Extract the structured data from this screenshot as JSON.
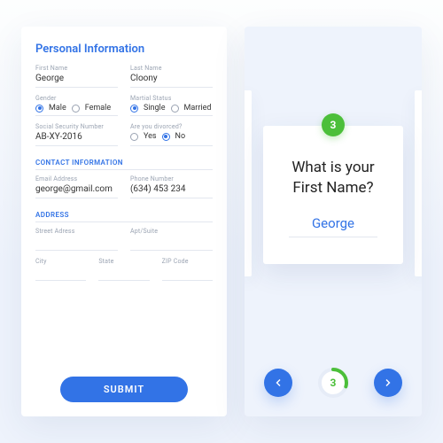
{
  "form": {
    "title": "Personal Information",
    "first_name_label": "First Name",
    "first_name_value": "George",
    "last_name_label": "Last Name",
    "last_name_value": "Cloony",
    "gender_label": "Gender",
    "gender_options": {
      "male": "Male",
      "female": "Female"
    },
    "gender_selected": "male",
    "marital_label": "Martial Status",
    "marital_options": {
      "single": "Single",
      "married": "Married"
    },
    "marital_selected": "single",
    "ssn_label": "Social Security Number",
    "ssn_value": "AB-XY-2016",
    "divorced_label": "Are you divorced?",
    "divorced_options": {
      "yes": "Yes",
      "no": "No"
    },
    "divorced_selected": "no",
    "contact_section": "CONTACT INFORMATION",
    "email_label": "Email Address",
    "email_value": "george@gmail.com",
    "phone_label": "Phone Number",
    "phone_value": "(634) 453 234",
    "address_section": "ADDRESS",
    "street_label": "Street Adress",
    "apt_label": "Apt/Suite",
    "city_label": "City",
    "state_label": "State",
    "zip_label": "ZIP Code",
    "submit_label": "SUBMIT"
  },
  "wizard": {
    "step_number": "3",
    "question": "What is your First Name?",
    "answer": "George",
    "progress_current": "3"
  },
  "colors": {
    "primary": "#3273e6",
    "accent": "#4cbf3a"
  }
}
